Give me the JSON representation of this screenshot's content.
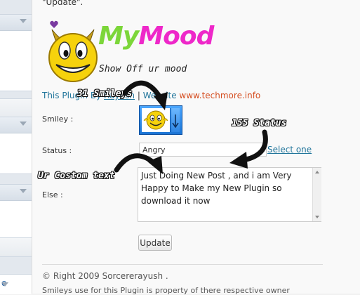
{
  "page": {
    "intro_text": "\"Update\"."
  },
  "logo": {
    "word_my": "My",
    "word_mood": "Mood",
    "tagline": "Show Off ur mood"
  },
  "credit": {
    "prefix": "This Plugin By",
    "author_link": "Rayush",
    "separator": "|",
    "website_label": "Website",
    "website_url": "www.techmore.info"
  },
  "form": {
    "smiley_label": "Smiley :",
    "status_label": "Status :",
    "status_value": "Angry",
    "select_one": "Select one",
    "else_label": "Else :",
    "else_text": "Just Doing New Post , and i am Very Happy to Make my New Plugin so download it now",
    "update_button": "Update"
  },
  "annotations": {
    "smileys_count": "31 Smileys",
    "status_count": "155 Status",
    "custom_text": "Ur Costom text"
  },
  "footer": {
    "copyright": "© Right 2009 Sorcererayush .",
    "disclaimer": "Smileys use for this Plugin is property of there respective owner"
  },
  "sidebar": {
    "bottom_fragment": "e"
  },
  "colors": {
    "link": "#21759b",
    "website": "#d54e21",
    "my": "#7cd63a",
    "mood": "#ee28c9"
  }
}
